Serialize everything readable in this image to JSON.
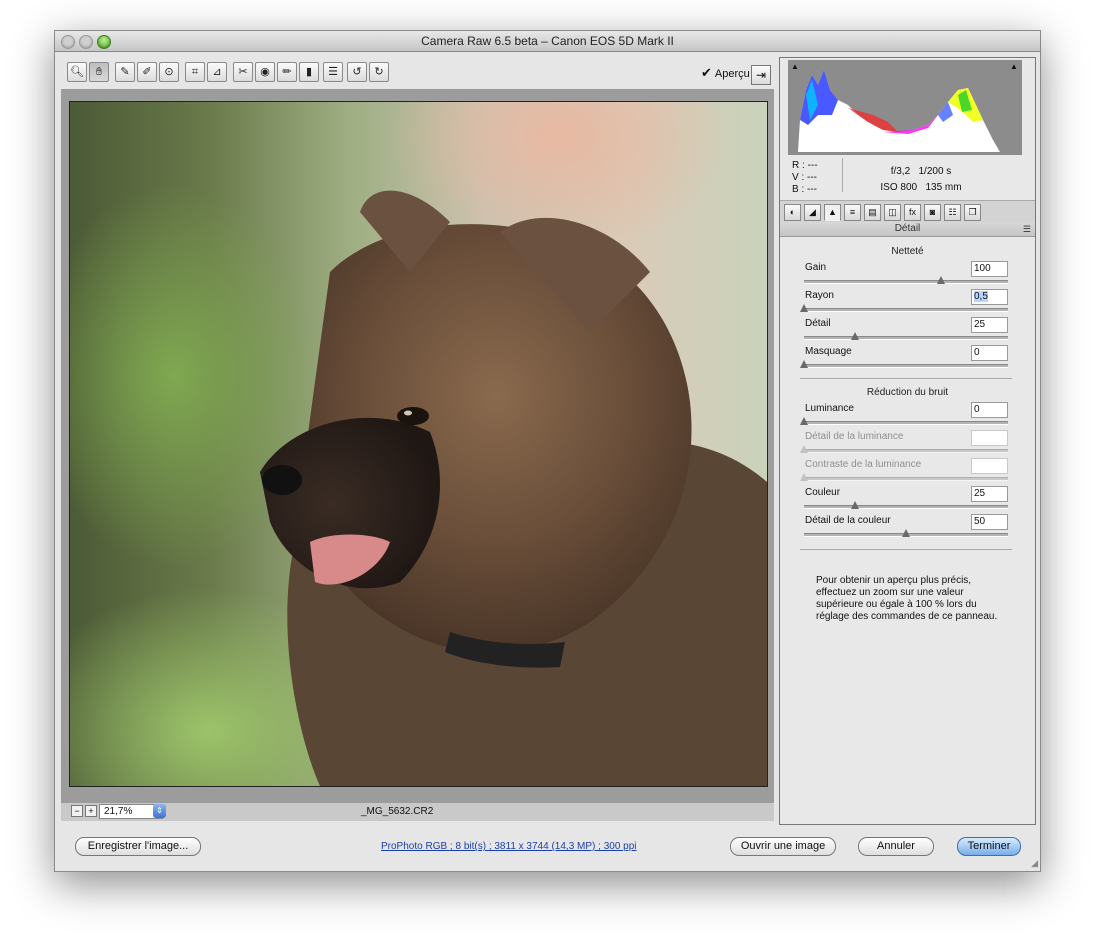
{
  "window": {
    "title": "Camera Raw 6.5 beta  –  Canon EOS 5D Mark II"
  },
  "toolbar": {
    "tools": [
      "zoom-icon",
      "hand-icon",
      "white-balance-icon",
      "color-sampler-icon",
      "target-adjust-icon",
      "crop-icon",
      "straighten-icon",
      "spot-removal-icon",
      "red-eye-icon",
      "adjustment-brush-icon",
      "graduated-filter-icon",
      "preferences-icon",
      "rotate-left-icon",
      "rotate-right-icon"
    ],
    "preview_label": "Aperçu"
  },
  "status": {
    "zoom_value": "21,7%",
    "filename": "_MG_5632.CR2"
  },
  "info": {
    "r_label": "R :",
    "r_value": "---",
    "v_label": "V :",
    "v_value": "---",
    "b_label": "B :",
    "b_value": "---",
    "aperture": "f/3,2",
    "shutter": "1/200 s",
    "iso": "ISO 800",
    "focal": "135 mm"
  },
  "panel": {
    "title": "Détail",
    "sharpening": {
      "title": "Netteté",
      "sliders": [
        {
          "label": "Gain",
          "value": "100",
          "fraction": 0.67
        },
        {
          "label": "Rayon",
          "value": "0,5",
          "fraction": 0.0
        },
        {
          "label": "Détail",
          "value": "25",
          "fraction": 0.25
        },
        {
          "label": "Masquage",
          "value": "0",
          "fraction": 0.0
        }
      ]
    },
    "noise": {
      "title": "Réduction du bruit",
      "sliders": [
        {
          "label": "Luminance",
          "value": "0",
          "fraction": 0.0,
          "disabled": false
        },
        {
          "label": "Détail de la luminance",
          "value": "",
          "fraction": 0.0,
          "disabled": true
        },
        {
          "label": "Contraste de la luminance",
          "value": "",
          "fraction": 0.0,
          "disabled": true
        },
        {
          "label": "Couleur",
          "value": "25",
          "fraction": 0.25,
          "disabled": false
        },
        {
          "label": "Détail de la couleur",
          "value": "50",
          "fraction": 0.5,
          "disabled": false
        }
      ]
    },
    "note": "Pour obtenir un aperçu plus précis, effectuez un zoom sur une valeur supérieure ou égale à 100 % lors du réglage des commandes de ce panneau."
  },
  "footer": {
    "save_label": "Enregistrer l'image...",
    "workflow_link": "ProPhoto RGB ; 8 bit(s) ; 3811 x 3744 (14,3 MP) ; 300 ppi",
    "open_label": "Ouvrir une image",
    "cancel_label": "Annuler",
    "done_label": "Terminer"
  },
  "colors": {
    "accent": "#78adea",
    "window_bg": "#e6e6e6",
    "canvas_bg": "#9c9c9c"
  }
}
